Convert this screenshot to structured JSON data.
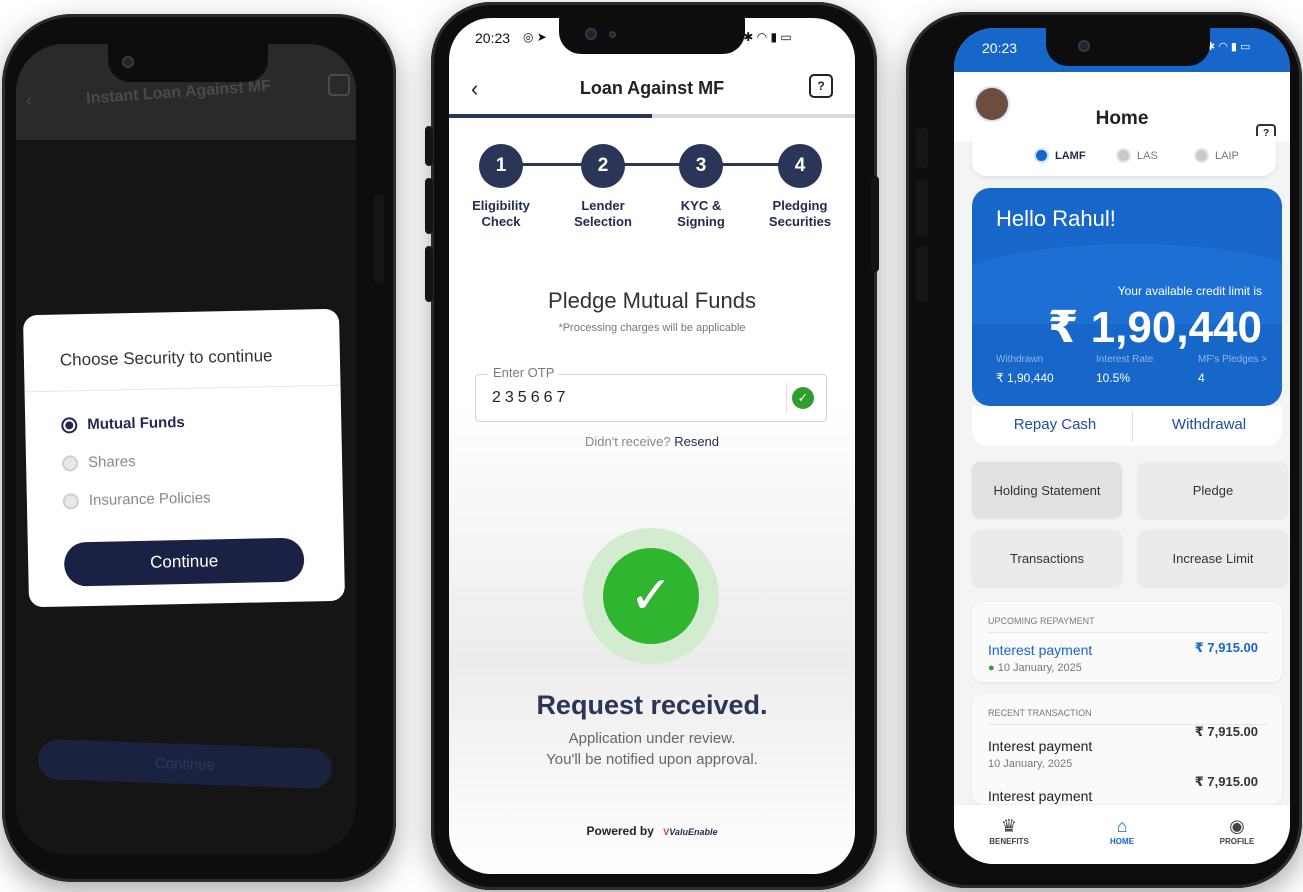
{
  "phone1": {
    "title": "Instant Loan Against MF",
    "modal": {
      "title": "Choose Security to continue",
      "options": [
        {
          "label": "Mutual Funds",
          "selected": true
        },
        {
          "label": "Shares",
          "selected": false
        },
        {
          "label": "Insurance Policies",
          "selected": false
        }
      ],
      "continue_label": "Continue"
    },
    "background_button": "Continue"
  },
  "phone2": {
    "status_time": "20:23",
    "title": "Loan Against MF",
    "progress": 0.5,
    "steps": [
      {
        "num": "1",
        "line1": "Eligibility",
        "line2": "Check"
      },
      {
        "num": "2",
        "line1": "Lender",
        "line2": "Selection"
      },
      {
        "num": "3",
        "line1": "KYC &",
        "line2": "Signing"
      },
      {
        "num": "4",
        "line1": "Pledging",
        "line2": "Securities"
      }
    ],
    "heading": "Pledge Mutual Funds",
    "note": "*Processing charges will be applicable",
    "otp": {
      "label": "Enter OTP",
      "value": "235667"
    },
    "resend_prefix": "Didn't receive?",
    "resend_link": "Resend",
    "success_title": "Request received.",
    "success_line1": "Application under review.",
    "success_line2": "You'll be notified upon approval.",
    "powered_by": "Powered by",
    "brand_name": "ValuEnable"
  },
  "phone3": {
    "status_time": "20:23",
    "title": "Home",
    "security_tabs": [
      {
        "label": "LAMF",
        "active": true
      },
      {
        "label": "LAS",
        "active": false
      },
      {
        "label": "LAIP",
        "active": false
      }
    ],
    "greeting": "Hello Rahul!",
    "credit_caption": "Your available credit limit is",
    "credit_amount": "₹ 1,90,440",
    "stats": [
      {
        "label": "Withdrawn",
        "value": "₹ 1,90,440"
      },
      {
        "label": "Interest Rate",
        "value": "10.5%"
      },
      {
        "label": "MF's Pledges >",
        "value": "4"
      }
    ],
    "actions": {
      "repay": "Repay Cash",
      "withdraw": "Withdrawal"
    },
    "tiles": [
      "Holding Statement",
      "Pledge",
      "Transactions",
      "Increase Limit"
    ],
    "upcoming": {
      "caption": "UPCOMING REPAYMENT",
      "item": {
        "label": "Interest payment",
        "date": "10 January, 2025",
        "amount": "₹ 7,915.00"
      }
    },
    "recent": {
      "caption": "RECENT TRANSACTION",
      "items": [
        {
          "label": "Interest payment",
          "date": "10 January, 2025",
          "amount": "₹ 7,915.00"
        },
        {
          "label": "Interest payment",
          "amount": "₹ 7,915.00"
        }
      ]
    },
    "nav": [
      {
        "label": "BENEFITS",
        "icon": "crown-icon"
      },
      {
        "label": "HOME",
        "icon": "home-icon"
      },
      {
        "label": "PROFILE",
        "icon": "profile-icon"
      }
    ]
  }
}
